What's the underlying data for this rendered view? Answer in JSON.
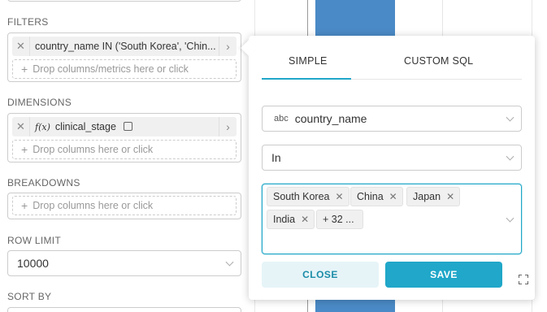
{
  "filters": {
    "label": "FILTERS",
    "chip_text": "country_name IN ('South Korea', 'Chin...",
    "drop_text": "Drop columns/metrics here or click"
  },
  "dimensions": {
    "label": "DIMENSIONS",
    "chip_text": "clinical_stage",
    "chip_prefix": "f(x)",
    "drop_text": "Drop columns here or click"
  },
  "breakdowns": {
    "label": "BREAKDOWNS",
    "drop_text": "Drop columns here or click"
  },
  "row_limit": {
    "label": "ROW LIMIT",
    "value": "10000"
  },
  "sort_by": {
    "label": "SORT BY"
  },
  "popover": {
    "tabs": [
      {
        "label": "SIMPLE",
        "active": true
      },
      {
        "label": "CUSTOM SQL",
        "active": false
      }
    ],
    "column": {
      "type_label": "abc",
      "value": "country_name"
    },
    "operator": "In",
    "values": [
      "South Korea",
      "China",
      "Japan",
      "India"
    ],
    "more_label": "+ 32 ...",
    "close_label": "CLOSE",
    "save_label": "SAVE"
  },
  "colors": {
    "accent": "#20a7c9",
    "bar": "#4a8ac6"
  }
}
